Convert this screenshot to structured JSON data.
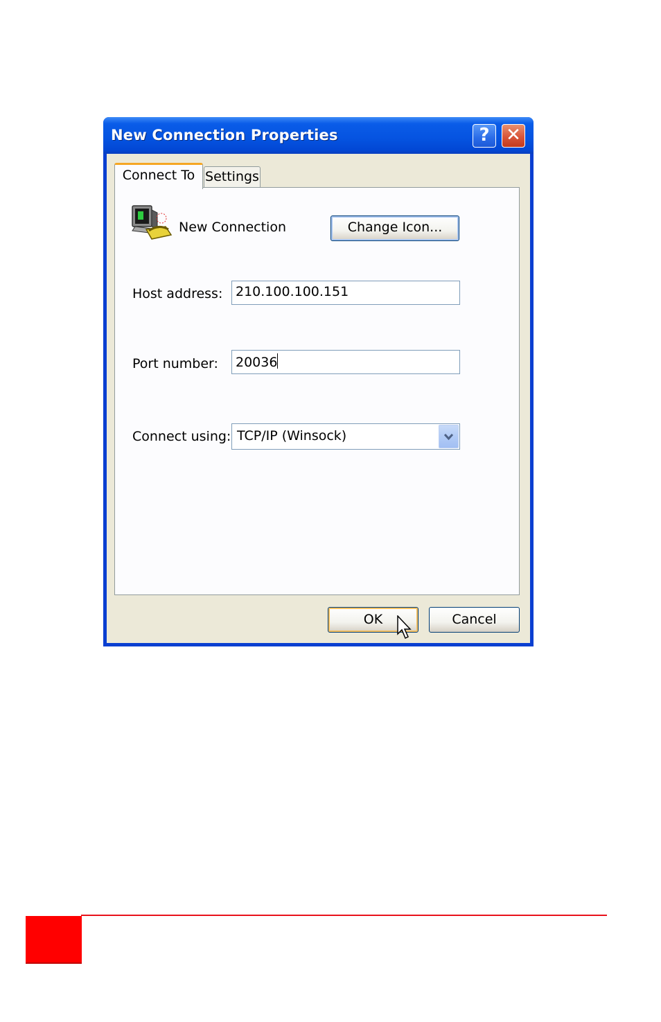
{
  "window": {
    "title": "New Connection Properties",
    "help_glyph": "?",
    "close_glyph": "✕"
  },
  "tabs": [
    {
      "label": "Connect To",
      "selected": true
    },
    {
      "label": "Settings",
      "selected": false
    }
  ],
  "connection": {
    "name": "New Connection",
    "icon": "phone-computer-icon",
    "change_icon_label": "Change Icon..."
  },
  "form": {
    "host_label": "Host address:",
    "host_value": "210.100.100.151",
    "port_label": "Port number:",
    "port_value": "20036",
    "connect_label": "Connect using:",
    "connect_value": "TCP/IP (Winsock)"
  },
  "footer": {
    "ok_label": "OK",
    "cancel_label": "Cancel"
  },
  "colors": {
    "titlebar": "#0553e0",
    "window_bg": "#ece9d8",
    "accent_tab": "#f5a623",
    "page_rule": "#e8111a",
    "page_block": "#ff0000"
  }
}
